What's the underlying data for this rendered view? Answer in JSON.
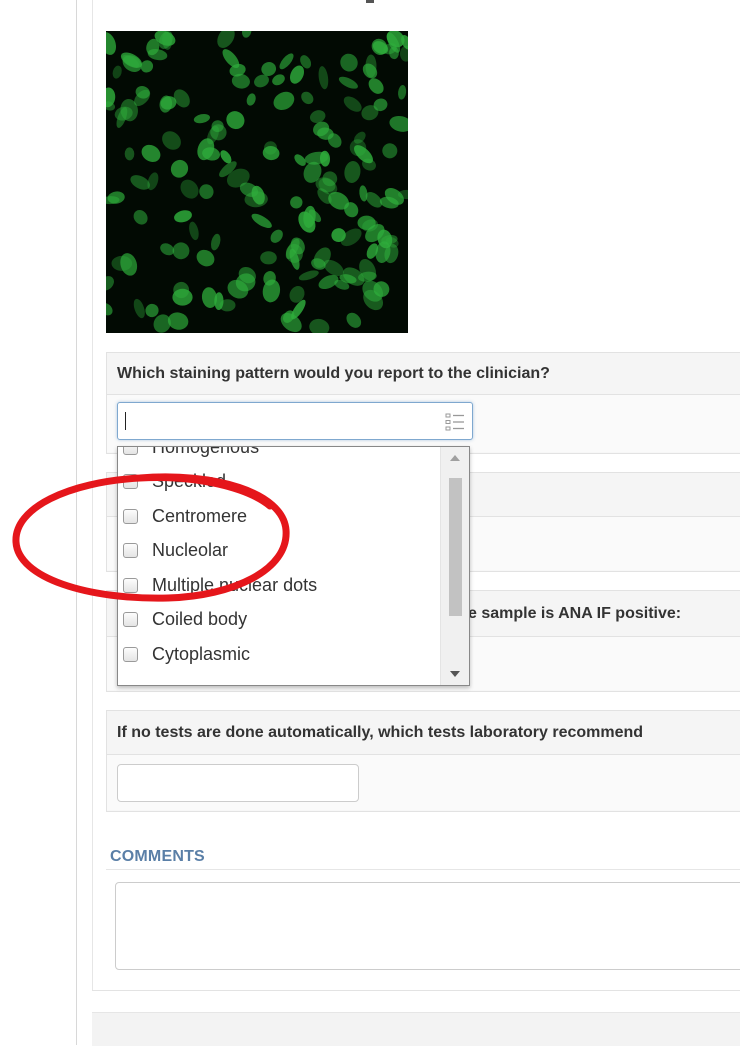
{
  "image": {
    "icon": "microscopy-image",
    "stain_color": "#2fae3c"
  },
  "question1": {
    "title": "Which staining pattern would you report to the clinician?",
    "input_value": "",
    "options": [
      "Homogenous",
      "Speckled",
      "Centromere",
      "Nucleolar",
      "Multiple nuclear dots",
      "Coiled body",
      "Cytoplasmic"
    ]
  },
  "question3": {
    "title_visible_part": "e sample is ANA IF positive:"
  },
  "question4": {
    "title": "If no tests are done automatically, which tests laboratory recommend",
    "input_value": ""
  },
  "comments": {
    "label": "COMMENTS",
    "value": ""
  },
  "colors": {
    "accent_label": "#5a7fa7",
    "annotation_circle": "#e5161b",
    "focus_border": "#7fa8cf"
  }
}
